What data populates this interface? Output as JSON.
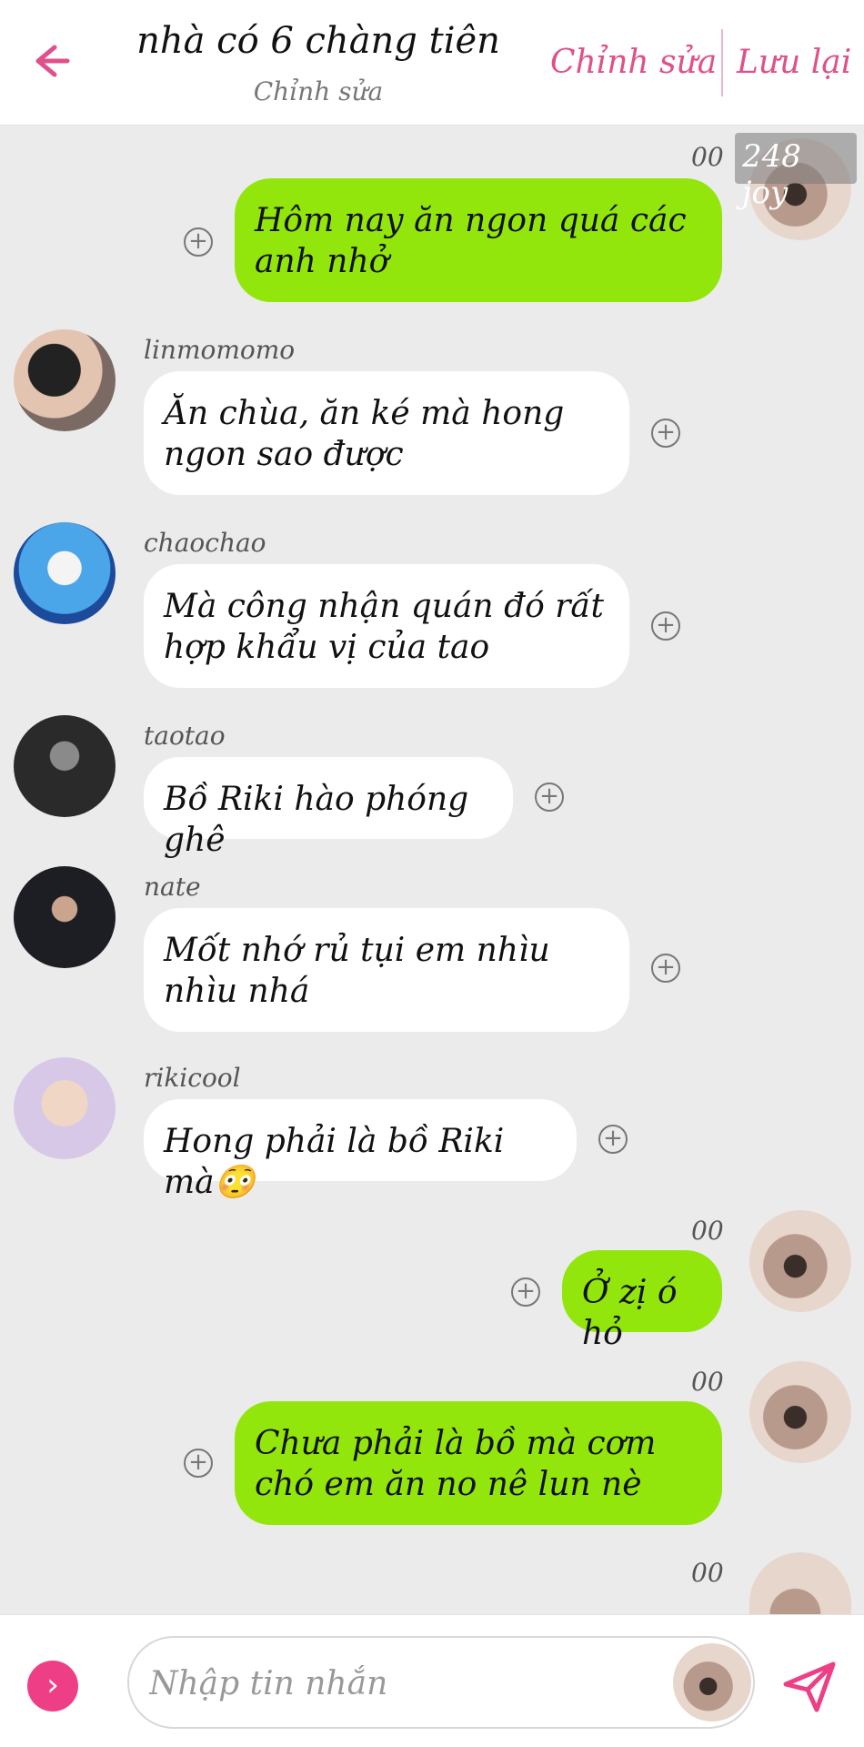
{
  "header": {
    "title": "nhà có 6 chàng tiên",
    "subtitle": "Chỉnh sửa",
    "edit_label": "Chỉnh sửa",
    "save_label": "Lưu lại",
    "accent": "#e0508a"
  },
  "watermark": "248 joy",
  "messages": [
    {
      "side": "out",
      "time": "00",
      "text": "Hôm nay ăn ngon quá các anh nhở"
    },
    {
      "side": "in",
      "name": "linmomomo",
      "text": "Ăn chùa, ăn ké mà hong ngon sao được"
    },
    {
      "side": "in",
      "name": "chaochao",
      "text": "Mà công nhận quán đó rất hợp khẩu vị của tao"
    },
    {
      "side": "in",
      "name": "taotao",
      "text": "Bồ Riki hào phóng ghê"
    },
    {
      "side": "in",
      "name": "nate",
      "text": "Mốt nhớ rủ tụi em nhìu nhìu nhá"
    },
    {
      "side": "in",
      "name": "rikicool",
      "text": "Hong phải là bồ Riki mà😳"
    },
    {
      "side": "out",
      "time": "00",
      "text": "Ở zị ó hỏ"
    },
    {
      "side": "out",
      "time": "00",
      "text": "Chưa phải là bồ mà cơm chó em ăn no nê lun nè"
    },
    {
      "side": "out",
      "time": "00",
      "text": ""
    }
  ],
  "composer": {
    "placeholder": "Nhập tin nhắn"
  },
  "colors": {
    "outgoing_bubble": "#92e60c",
    "incoming_bubble": "#ffffff",
    "background": "#ebebeb",
    "composer_button": "#ee3f86"
  }
}
